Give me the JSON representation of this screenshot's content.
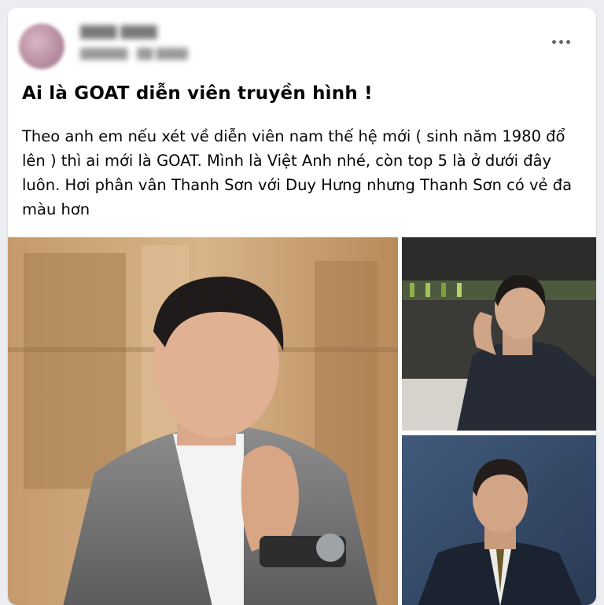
{
  "post": {
    "title": "Ai là GOAT diễn viên truyền hình !",
    "body": "Theo anh em nếu xét về diễn viên nam thế hệ mới ( sinh năm 1980 đổ lên ) thì ai mới là GOAT. Mình là Việt Anh nhé, còn top 5 là ở dưới đây luôn. Hơi phân vân Thanh Sơn với Duy Hưng nhưng Thanh Sơn có vẻ đa màu hơn"
  },
  "icons": {
    "more": "more-options-icon"
  },
  "colors": {
    "page_background": "#ecedf0",
    "card_background": "#ffffff",
    "text": "#050505"
  }
}
